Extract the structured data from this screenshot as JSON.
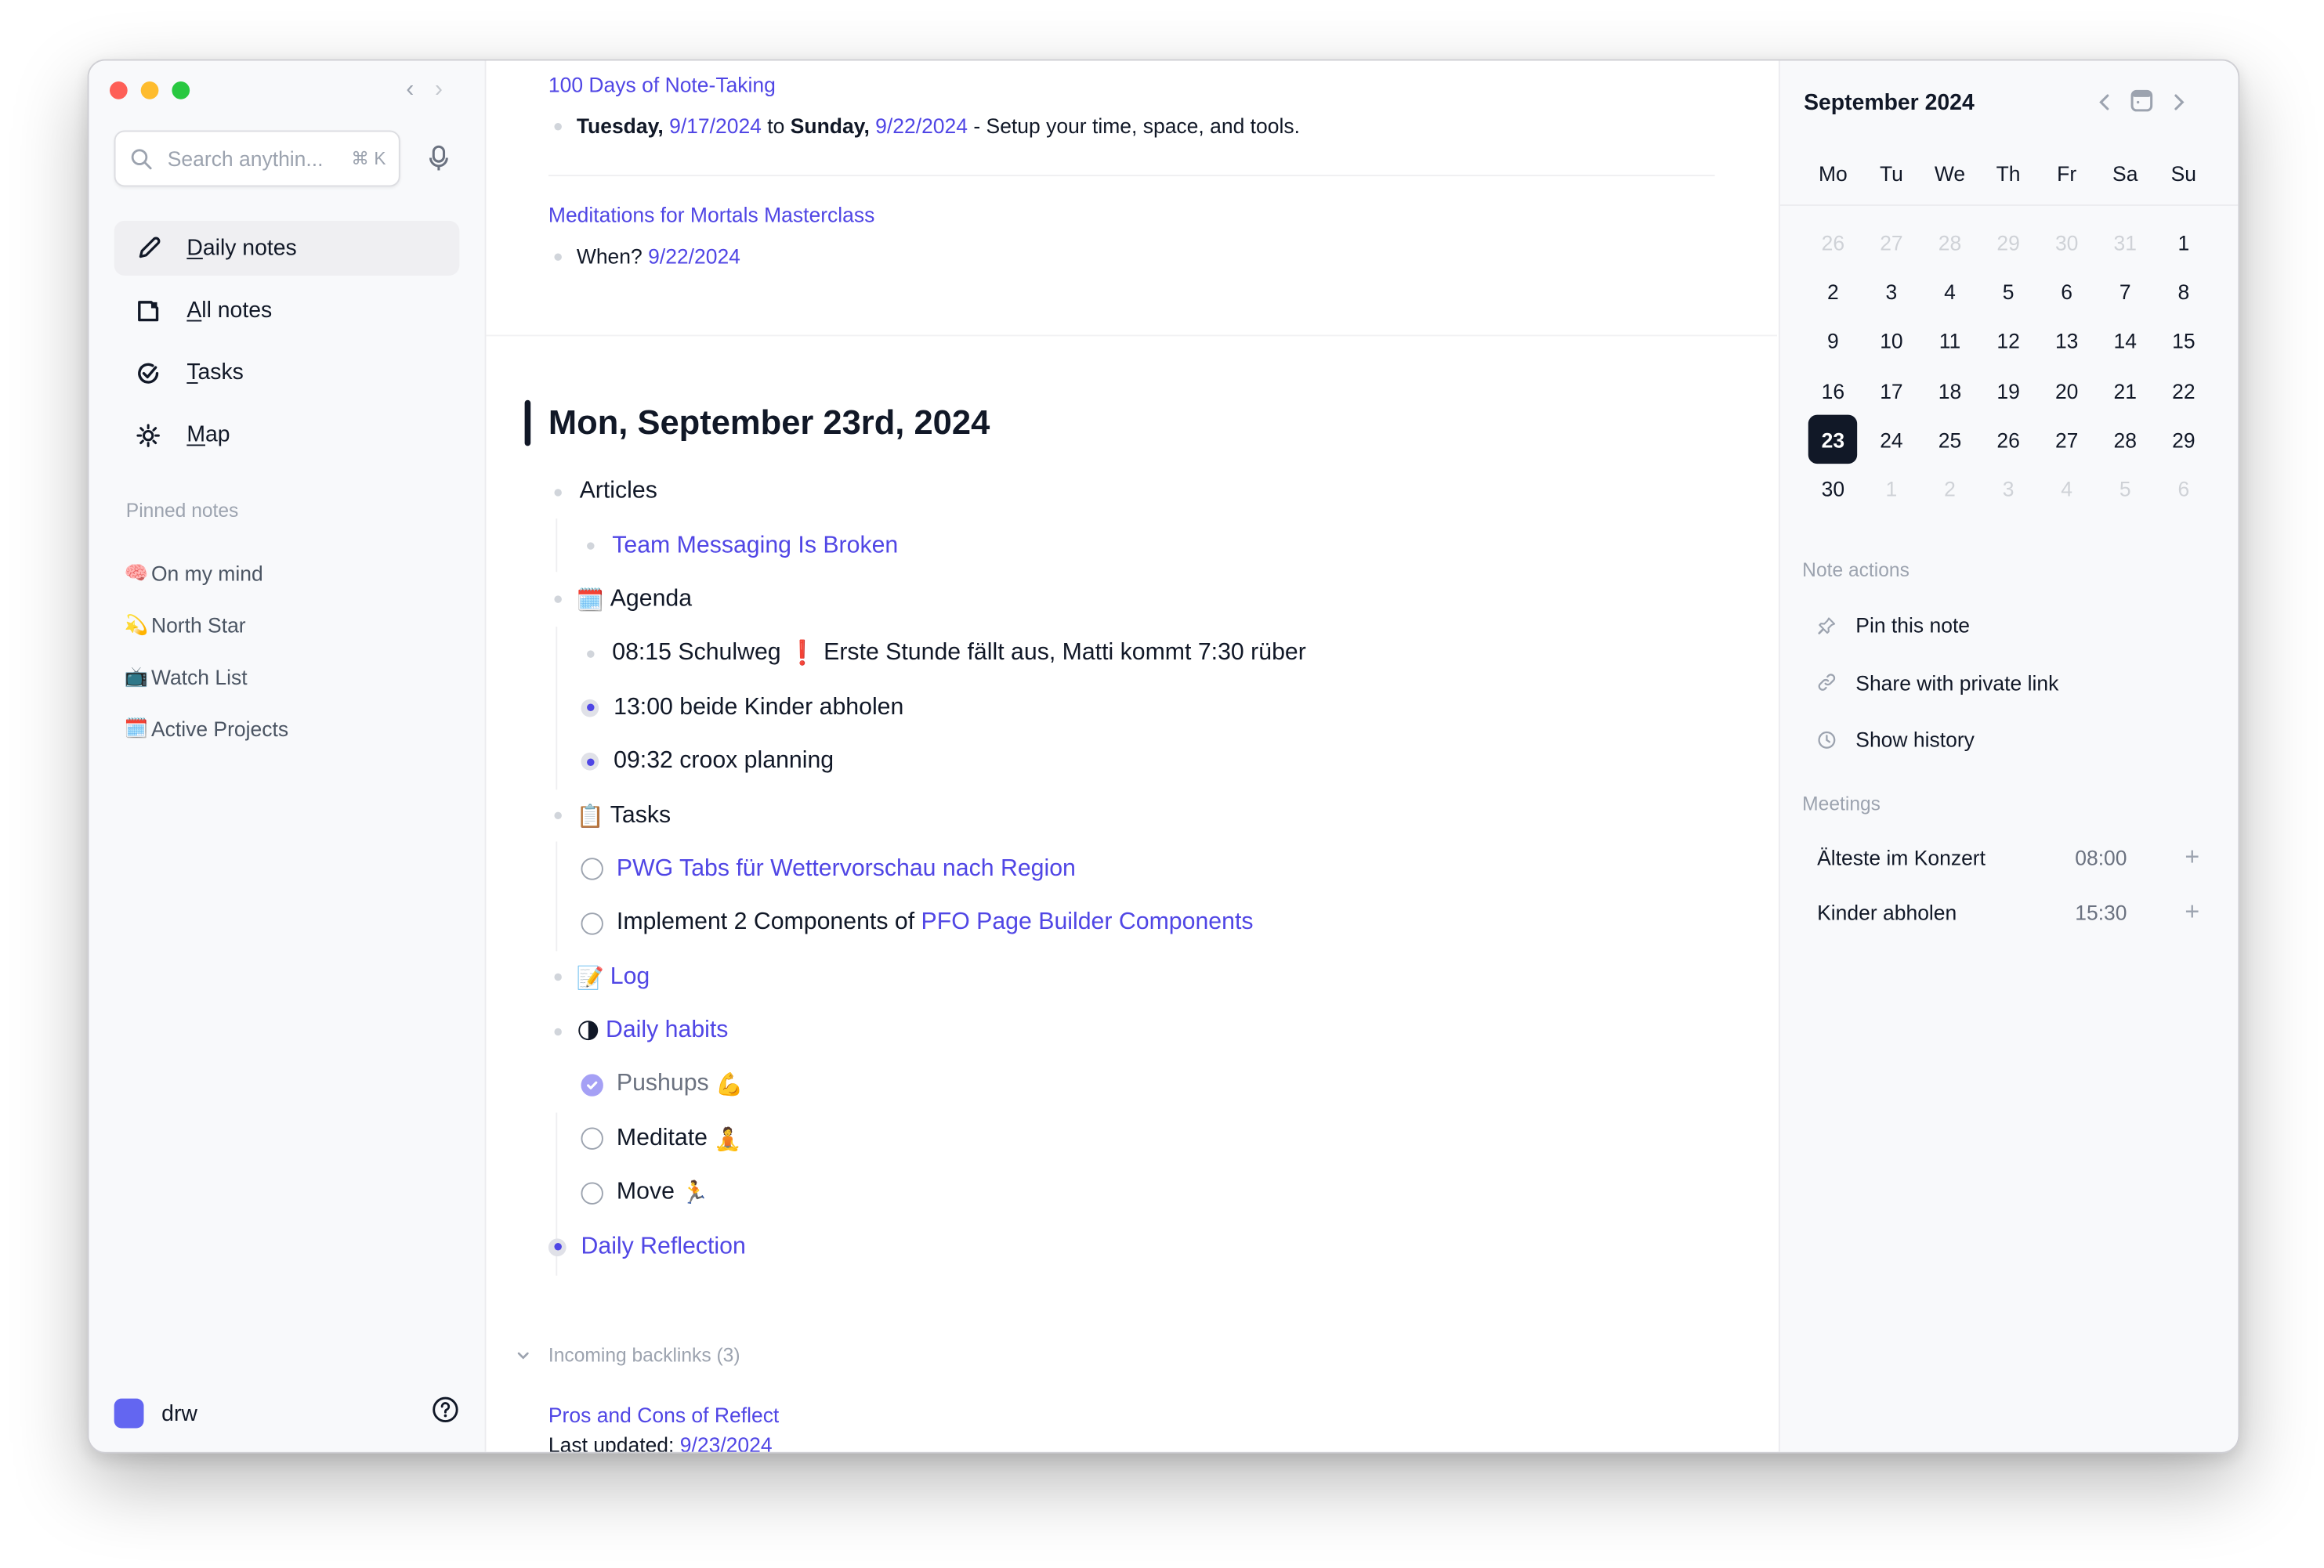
{
  "sidebar": {
    "search": {
      "placeholder": "Search anythin...",
      "value": "",
      "shortcut": "⌘ K"
    },
    "nav": [
      {
        "key": "D",
        "rest": "aily notes",
        "icon": "pencil-icon",
        "active": true
      },
      {
        "key": "A",
        "rest": "ll notes",
        "icon": "note-icon",
        "active": false
      },
      {
        "key": "T",
        "rest": "asks",
        "icon": "check-circle-icon",
        "active": false
      },
      {
        "key": "M",
        "rest": "ap",
        "icon": "sun-icon",
        "active": false
      }
    ],
    "pinned_title": "Pinned notes",
    "pinned": [
      {
        "emoji": "🧠",
        "label": "On my mind"
      },
      {
        "emoji": "💫",
        "label": "North Star"
      },
      {
        "emoji": "📺",
        "label": "Watch List"
      },
      {
        "emoji": "🗓️",
        "label": "Active Projects"
      }
    ],
    "user": {
      "name": "drw",
      "avatar_color": "#6366f1"
    }
  },
  "main": {
    "previous": {
      "note1": {
        "title": "100 Days of Note-Taking",
        "line": {
          "day1": "Tuesday,",
          "date1": "9/17/2024",
          "to": "to",
          "day2": "Sunday,",
          "date2": "9/22/2024",
          "rest": "- Setup your time, space, and tools."
        }
      },
      "note2": {
        "title": "Meditations for Mortals Masterclass",
        "line": {
          "prefix": "When?",
          "date": "9/22/2024"
        }
      }
    },
    "heading": "Mon, September 23rd, 2024",
    "blocks": {
      "articles": "Articles",
      "article_link": "Team Messaging Is Broken",
      "agenda_emoji": "🗓️",
      "agenda": "Agenda",
      "agenda_items": [
        {
          "before": "08:15 Schulweg",
          "emoji": "❗",
          "after": "Erste Stunde fällt aus, Matti kommt 7:30 rüber",
          "active": false
        },
        {
          "text": "13:00 beide Kinder abholen",
          "active": true
        },
        {
          "text": "09:32 croox planning",
          "active": true
        }
      ],
      "tasks_emoji": "📋",
      "tasks": "Tasks",
      "task_items": [
        {
          "link": "PWG Tabs für Wettervorschau nach Region",
          "done": false
        },
        {
          "text": "Implement 2 Components of",
          "link": "PFO Page Builder Components",
          "done": false
        }
      ],
      "log_emoji": "📝",
      "log": "Log",
      "habits_emoji": "🌗",
      "habits": "Daily habits",
      "habit_items": [
        {
          "text": "Pushups",
          "emoji": "💪",
          "done": true
        },
        {
          "text": "Meditate",
          "emoji": "🧘",
          "done": false
        },
        {
          "text": "Move",
          "emoji": "🏃",
          "done": false
        }
      ],
      "reflection": "Daily Reflection"
    },
    "backlinks": {
      "label": "Incoming backlinks (3)",
      "items": [
        {
          "title": "Pros and Cons of Reflect",
          "meta_label": "Last updated:",
          "meta_date": "9/23/2024"
        }
      ]
    }
  },
  "calendar": {
    "title": "September 2024",
    "weekdays": [
      "Mo",
      "Tu",
      "We",
      "Th",
      "Fr",
      "Sa",
      "Su"
    ],
    "days": [
      {
        "d": "26",
        "m": true
      },
      {
        "d": "27",
        "m": true
      },
      {
        "d": "28",
        "m": true
      },
      {
        "d": "29",
        "m": true
      },
      {
        "d": "30",
        "m": true
      },
      {
        "d": "31",
        "m": true
      },
      {
        "d": "1"
      },
      {
        "d": "2"
      },
      {
        "d": "3"
      },
      {
        "d": "4"
      },
      {
        "d": "5"
      },
      {
        "d": "6"
      },
      {
        "d": "7"
      },
      {
        "d": "8"
      },
      {
        "d": "9"
      },
      {
        "d": "10"
      },
      {
        "d": "11"
      },
      {
        "d": "12"
      },
      {
        "d": "13"
      },
      {
        "d": "14"
      },
      {
        "d": "15"
      },
      {
        "d": "16"
      },
      {
        "d": "17"
      },
      {
        "d": "18"
      },
      {
        "d": "19"
      },
      {
        "d": "20"
      },
      {
        "d": "21"
      },
      {
        "d": "22"
      },
      {
        "d": "23",
        "sel": true
      },
      {
        "d": "24"
      },
      {
        "d": "25"
      },
      {
        "d": "26"
      },
      {
        "d": "27"
      },
      {
        "d": "28"
      },
      {
        "d": "29"
      },
      {
        "d": "30"
      },
      {
        "d": "1",
        "m": true
      },
      {
        "d": "2",
        "m": true
      },
      {
        "d": "3",
        "m": true
      },
      {
        "d": "4",
        "m": true
      },
      {
        "d": "5",
        "m": true
      },
      {
        "d": "6",
        "m": true
      }
    ]
  },
  "note_actions": {
    "label": "Note actions",
    "items": [
      {
        "label": "Pin this note",
        "icon": "pin-icon"
      },
      {
        "label": "Share with private link",
        "icon": "link-icon"
      },
      {
        "label": "Show history",
        "icon": "clock-icon"
      }
    ]
  },
  "meetings": {
    "label": "Meetings",
    "items": [
      {
        "name": "Älteste im Konzert",
        "time": "08:00",
        "add": "+"
      },
      {
        "name": "Kinder abholen",
        "time": "15:30",
        "add": "+"
      }
    ]
  },
  "colors": {
    "accent": "#5046e5",
    "selected_day": "#111827"
  }
}
